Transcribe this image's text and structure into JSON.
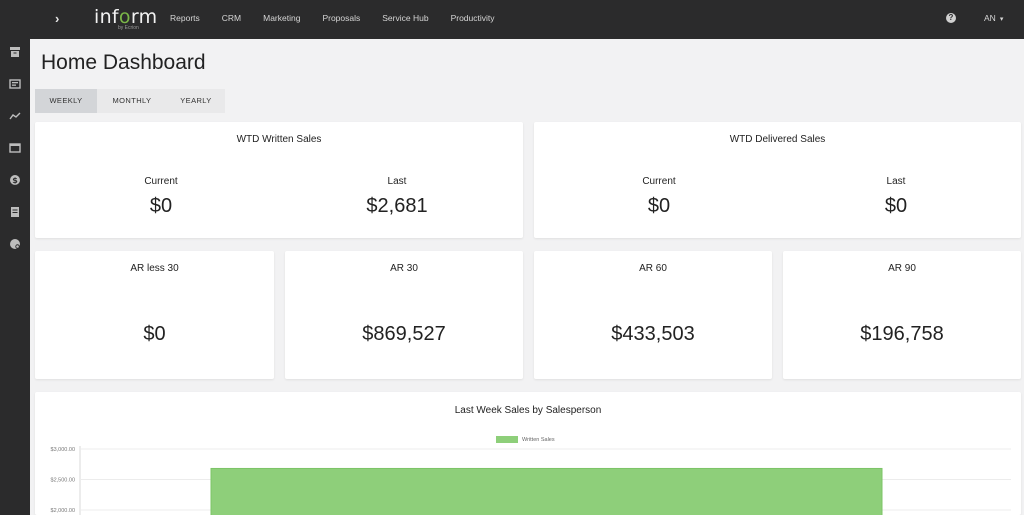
{
  "topbar": {
    "logo_text_pre": "inf",
    "logo_text_dot": "o",
    "logo_text_post": "rm",
    "logo_sub": "by Ecrion",
    "nav": [
      "Reports",
      "CRM",
      "Marketing",
      "Proposals",
      "Service Hub",
      "Productivity"
    ],
    "user_initials": "AN",
    "expand_glyph": "›",
    "help_glyph": "?"
  },
  "sidebar": {
    "icons": [
      "archive-icon",
      "inbox-icon",
      "trend-line-icon",
      "window-icon",
      "dollar-icon",
      "document-icon",
      "palette-icon"
    ]
  },
  "page": {
    "title": "Home Dashboard",
    "period_tabs": [
      "WEEKLY",
      "MONTHLY",
      "YEARLY"
    ],
    "active_period": "WEEKLY"
  },
  "cards": {
    "written": {
      "title": "WTD Written Sales",
      "current_label": "Current",
      "current_value": "$0",
      "last_label": "Last",
      "last_value": "$2,681"
    },
    "delivered": {
      "title": "WTD Delivered Sales",
      "current_label": "Current",
      "current_value": "$0",
      "last_label": "Last",
      "last_value": "$0"
    },
    "ar": [
      {
        "title": "AR less 30",
        "value": "$0"
      },
      {
        "title": "AR 30",
        "value": "$869,527"
      },
      {
        "title": "AR 60",
        "value": "$433,503"
      },
      {
        "title": "AR 90",
        "value": "$196,758"
      }
    ]
  },
  "colors": {
    "topbar": "#2b2b2c",
    "accent_green": "#7ab648",
    "bar_green": "#8ecf7a"
  },
  "chart_data": {
    "type": "bar",
    "title": "Last Week Sales by Salesperson",
    "series": [
      {
        "name": "Written Sales",
        "values": [
          2681
        ]
      }
    ],
    "categories": [
      ""
    ],
    "y_ticks": [
      "$3,000.00",
      "$2,500.00",
      "$2,000.00"
    ],
    "ylim": [
      0,
      3000
    ],
    "grid": true,
    "legend": "top-center"
  }
}
